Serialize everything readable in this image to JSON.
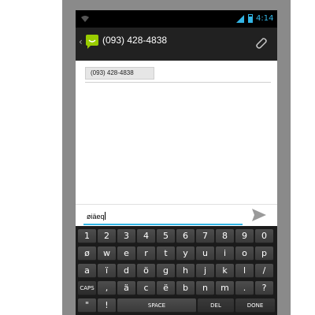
{
  "status_bar": {
    "time": "4:14"
  },
  "action_bar": {
    "back_glyph": "‹",
    "title": "(093) 428-4838"
  },
  "recipient": {
    "chip": "(093) 428-4838"
  },
  "compose": {
    "text": "øiäeq"
  },
  "keyboard": {
    "row1": [
      "1",
      "2",
      "3",
      "4",
      "5",
      "6",
      "7",
      "8",
      "9",
      "0"
    ],
    "row2": [
      "ø",
      "w",
      "e",
      "r",
      "t",
      "y",
      "u",
      "i",
      "o",
      "p"
    ],
    "row3": [
      "a",
      "ï",
      "d",
      "ö",
      "g",
      "h",
      "j",
      "k",
      "l",
      "/"
    ],
    "row4": [
      "CAPS",
      ",",
      "ä",
      "c",
      "ë",
      "b",
      "n",
      "m",
      ".",
      "?"
    ],
    "row5": [
      "\"",
      "!",
      "SPACE",
      "DEL",
      "DONE"
    ]
  },
  "colors": {
    "accent": "#33b5e5",
    "app_icon": "#99cc00",
    "action_bar": "#212121",
    "keyboard_bg": "#1b1b1b",
    "key": "#444444"
  },
  "icons": {
    "app": "message-app-icon",
    "attach": "paperclip-icon",
    "send": "send-icon"
  }
}
